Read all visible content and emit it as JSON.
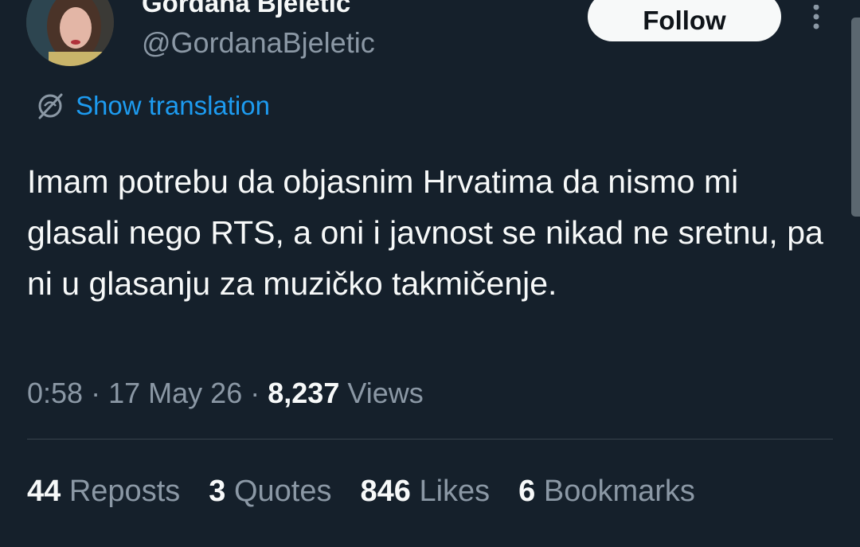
{
  "author": {
    "display_name": "Gordana Bjeletic",
    "handle": "@GordanaBjeletic"
  },
  "follow_label": "Follow",
  "translation_label": "Show translation",
  "tweet_text": "Imam potrebu da objasnim Hrvatima da nismo mi glasali nego RTS, a oni i javnost se nikad ne sretnu, pa ni u glasanju za muzičko takmičenje.",
  "meta": {
    "time": "0:58",
    "separator": "·",
    "date": "17 May 26",
    "views_count": "8,237",
    "views_label": "Views"
  },
  "stats": [
    {
      "count": "44",
      "label": "Reposts"
    },
    {
      "count": "3",
      "label": "Quotes"
    },
    {
      "count": "846",
      "label": "Likes"
    },
    {
      "count": "6",
      "label": "Bookmarks"
    }
  ],
  "colors": {
    "background": "#15202b",
    "primary_text": "#f7f9f9",
    "secondary_text": "#8b98a5",
    "accent": "#1d9bf0"
  },
  "icons": {
    "translation": "translate-icon",
    "more": "more-options-icon"
  }
}
